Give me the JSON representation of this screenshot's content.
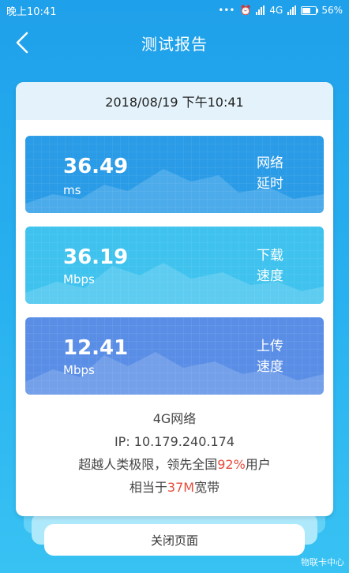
{
  "status_bar": {
    "time": "晚上10:41",
    "network": "4G",
    "battery": "56%"
  },
  "nav": {
    "title": "测试报告"
  },
  "report": {
    "datetime": "2018/08/19 下午10:41",
    "metrics": [
      {
        "value": "36.49",
        "unit": "ms",
        "label": "网络延时",
        "color": "#2a9be6"
      },
      {
        "value": "36.19",
        "unit": "Mbps",
        "label": "下载速度",
        "color": "#3fc3ee"
      },
      {
        "value": "12.41",
        "unit": "Mbps",
        "label": "上传速度",
        "color": "#5a8ee6"
      }
    ],
    "network_type": "4G网络",
    "ip_line": "IP: 10.179.240.174",
    "rank_prefix": "超越人类极限，领先全国",
    "rank_percent": "92%",
    "rank_suffix": "用户",
    "equiv_prefix": "相当于",
    "equiv_bandwidth": "37M",
    "equiv_suffix": "宽带"
  },
  "footer": {
    "close_label": "关闭页面",
    "watermark": "物联卡中心"
  }
}
